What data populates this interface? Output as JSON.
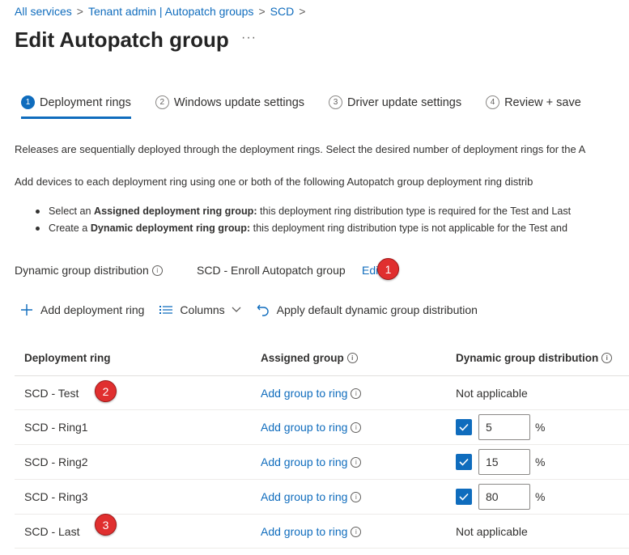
{
  "breadcrumb": {
    "items": [
      "All services",
      "Tenant admin | Autopatch groups",
      "SCD"
    ],
    "separator": ">"
  },
  "page": {
    "title": "Edit Autopatch group",
    "more": "···"
  },
  "tabs": [
    {
      "num": "1",
      "label": "Deployment rings",
      "active": true
    },
    {
      "num": "2",
      "label": "Windows update settings"
    },
    {
      "num": "3",
      "label": "Driver update settings"
    },
    {
      "num": "4",
      "label": "Review + save"
    }
  ],
  "description": {
    "line1": "Releases are sequentially deployed through the deployment rings. Select the desired number of deployment rings for the A",
    "line2": "Add devices to each deployment ring using one or both of the following Autopatch group deployment ring distrib",
    "bullets": [
      {
        "prefix": "Select an ",
        "bold": "Assigned deployment ring group:",
        "rest": " this deployment ring distribution type is required for the Test and Last"
      },
      {
        "prefix": "Create a ",
        "bold": "Dynamic deployment ring group:",
        "rest": " this deployment ring distribution type is not applicable for the Test and"
      }
    ]
  },
  "distribution": {
    "label": "Dynamic group distribution",
    "value": "SCD - Enroll Autopatch group",
    "edit": "Edit"
  },
  "markers": [
    "1",
    "2",
    "3"
  ],
  "toolbar": {
    "add": "Add deployment ring",
    "columns": "Columns",
    "apply": "Apply default dynamic group distribution"
  },
  "table": {
    "headers": {
      "ring": "Deployment ring",
      "assigned": "Assigned group",
      "dynamic": "Dynamic group distribution"
    },
    "add_link": "Add group to ring",
    "not_applicable": "Not applicable",
    "pct_sign": "%",
    "rows": [
      {
        "name": "SCD - Test"
      },
      {
        "name": "SCD - Ring1",
        "value": "5",
        "checked": true
      },
      {
        "name": "SCD - Ring2",
        "value": "15",
        "checked": true
      },
      {
        "name": "SCD - Ring3",
        "value": "80",
        "checked": true
      },
      {
        "name": "SCD - Last"
      }
    ]
  },
  "colors": {
    "accent": "#0f6cbd",
    "marker": "#e02f2f"
  }
}
